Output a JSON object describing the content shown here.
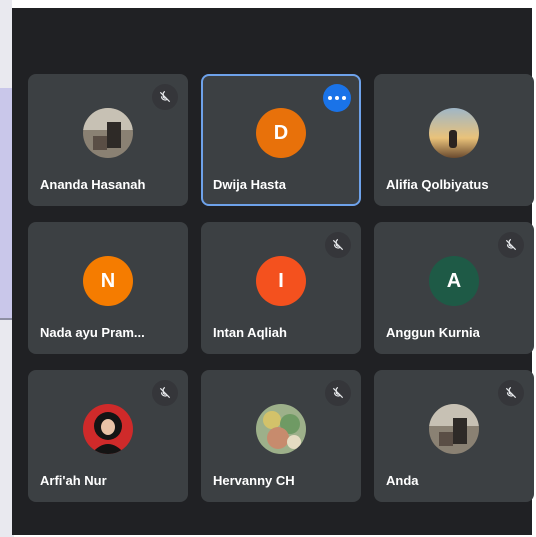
{
  "colors": {
    "stage": "#202124",
    "tile": "#3c4043",
    "active_border": "#6ea2ea",
    "more_button": "#1a73e8"
  },
  "participants": [
    {
      "name": "Ananda Hasanah",
      "avatar": "photo",
      "muted": true
    },
    {
      "name": "Dwija Hasta",
      "avatar": "initial",
      "initial": "D",
      "avatar_color": "#e8710a",
      "active": true,
      "more_options": true
    },
    {
      "name": "Alifia Qolbiyatus",
      "avatar": "photo",
      "muted": false
    },
    {
      "name": "Nada ayu Pram...",
      "avatar": "initial",
      "initial": "N",
      "avatar_color": "#f57c00",
      "muted": false
    },
    {
      "name": "Intan Aqliah",
      "avatar": "initial",
      "initial": "I",
      "avatar_color": "#f4511e",
      "muted": true
    },
    {
      "name": "Anggun Kurnia",
      "avatar": "initial",
      "initial": "A",
      "avatar_color": "#1e5a46",
      "muted": true
    },
    {
      "name": "Arfi'ah Nur",
      "avatar": "photo",
      "muted": true
    },
    {
      "name": "Hervanny CH",
      "avatar": "photo",
      "muted": true
    },
    {
      "name": "Anda",
      "avatar": "photo",
      "muted": true
    }
  ]
}
